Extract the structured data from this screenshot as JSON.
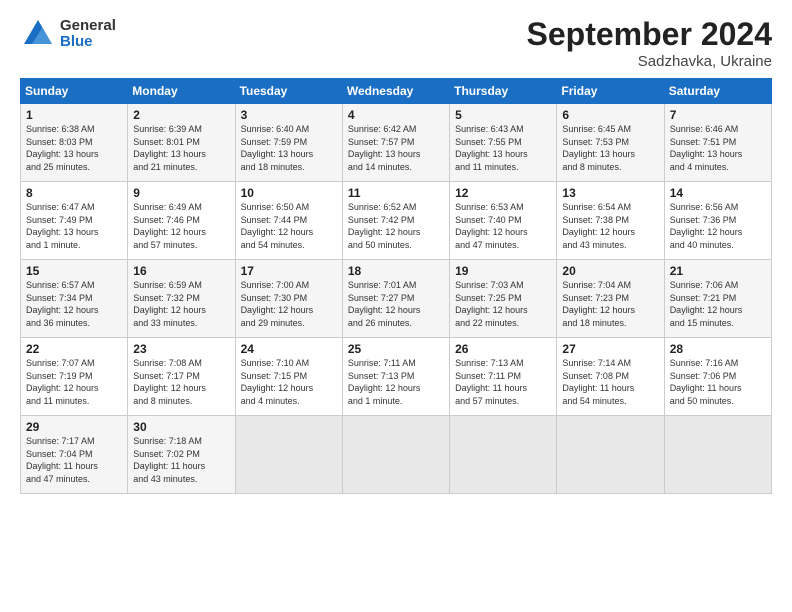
{
  "header": {
    "logo_general": "General",
    "logo_blue": "Blue",
    "title": "September 2024",
    "location": "Sadzhavka, Ukraine"
  },
  "days_of_week": [
    "Sunday",
    "Monday",
    "Tuesday",
    "Wednesday",
    "Thursday",
    "Friday",
    "Saturday"
  ],
  "weeks": [
    [
      {
        "day": 1,
        "sunrise": "6:38 AM",
        "sunset": "8:03 PM",
        "daylight": "13 hours and 25 minutes."
      },
      {
        "day": 2,
        "sunrise": "6:39 AM",
        "sunset": "8:01 PM",
        "daylight": "13 hours and 21 minutes."
      },
      {
        "day": 3,
        "sunrise": "6:40 AM",
        "sunset": "7:59 PM",
        "daylight": "13 hours and 18 minutes."
      },
      {
        "day": 4,
        "sunrise": "6:42 AM",
        "sunset": "7:57 PM",
        "daylight": "13 hours and 14 minutes."
      },
      {
        "day": 5,
        "sunrise": "6:43 AM",
        "sunset": "7:55 PM",
        "daylight": "13 hours and 11 minutes."
      },
      {
        "day": 6,
        "sunrise": "6:45 AM",
        "sunset": "7:53 PM",
        "daylight": "13 hours and 8 minutes."
      },
      {
        "day": 7,
        "sunrise": "6:46 AM",
        "sunset": "7:51 PM",
        "daylight": "13 hours and 4 minutes."
      }
    ],
    [
      {
        "day": 8,
        "sunrise": "6:47 AM",
        "sunset": "7:49 PM",
        "daylight": "13 hours and 1 minute."
      },
      {
        "day": 9,
        "sunrise": "6:49 AM",
        "sunset": "7:46 PM",
        "daylight": "12 hours and 57 minutes."
      },
      {
        "day": 10,
        "sunrise": "6:50 AM",
        "sunset": "7:44 PM",
        "daylight": "12 hours and 54 minutes."
      },
      {
        "day": 11,
        "sunrise": "6:52 AM",
        "sunset": "7:42 PM",
        "daylight": "12 hours and 50 minutes."
      },
      {
        "day": 12,
        "sunrise": "6:53 AM",
        "sunset": "7:40 PM",
        "daylight": "12 hours and 47 minutes."
      },
      {
        "day": 13,
        "sunrise": "6:54 AM",
        "sunset": "7:38 PM",
        "daylight": "12 hours and 43 minutes."
      },
      {
        "day": 14,
        "sunrise": "6:56 AM",
        "sunset": "7:36 PM",
        "daylight": "12 hours and 40 minutes."
      }
    ],
    [
      {
        "day": 15,
        "sunrise": "6:57 AM",
        "sunset": "7:34 PM",
        "daylight": "12 hours and 36 minutes."
      },
      {
        "day": 16,
        "sunrise": "6:59 AM",
        "sunset": "7:32 PM",
        "daylight": "12 hours and 33 minutes."
      },
      {
        "day": 17,
        "sunrise": "7:00 AM",
        "sunset": "7:30 PM",
        "daylight": "12 hours and 29 minutes."
      },
      {
        "day": 18,
        "sunrise": "7:01 AM",
        "sunset": "7:27 PM",
        "daylight": "12 hours and 26 minutes."
      },
      {
        "day": 19,
        "sunrise": "7:03 AM",
        "sunset": "7:25 PM",
        "daylight": "12 hours and 22 minutes."
      },
      {
        "day": 20,
        "sunrise": "7:04 AM",
        "sunset": "7:23 PM",
        "daylight": "12 hours and 18 minutes."
      },
      {
        "day": 21,
        "sunrise": "7:06 AM",
        "sunset": "7:21 PM",
        "daylight": "12 hours and 15 minutes."
      }
    ],
    [
      {
        "day": 22,
        "sunrise": "7:07 AM",
        "sunset": "7:19 PM",
        "daylight": "12 hours and 11 minutes."
      },
      {
        "day": 23,
        "sunrise": "7:08 AM",
        "sunset": "7:17 PM",
        "daylight": "12 hours and 8 minutes."
      },
      {
        "day": 24,
        "sunrise": "7:10 AM",
        "sunset": "7:15 PM",
        "daylight": "12 hours and 4 minutes."
      },
      {
        "day": 25,
        "sunrise": "7:11 AM",
        "sunset": "7:13 PM",
        "daylight": "12 hours and 1 minute."
      },
      {
        "day": 26,
        "sunrise": "7:13 AM",
        "sunset": "7:11 PM",
        "daylight": "11 hours and 57 minutes."
      },
      {
        "day": 27,
        "sunrise": "7:14 AM",
        "sunset": "7:08 PM",
        "daylight": "11 hours and 54 minutes."
      },
      {
        "day": 28,
        "sunrise": "7:16 AM",
        "sunset": "7:06 PM",
        "daylight": "11 hours and 50 minutes."
      }
    ],
    [
      {
        "day": 29,
        "sunrise": "7:17 AM",
        "sunset": "7:04 PM",
        "daylight": "11 hours and 47 minutes."
      },
      {
        "day": 30,
        "sunrise": "7:18 AM",
        "sunset": "7:02 PM",
        "daylight": "11 hours and 43 minutes."
      },
      null,
      null,
      null,
      null,
      null
    ]
  ]
}
